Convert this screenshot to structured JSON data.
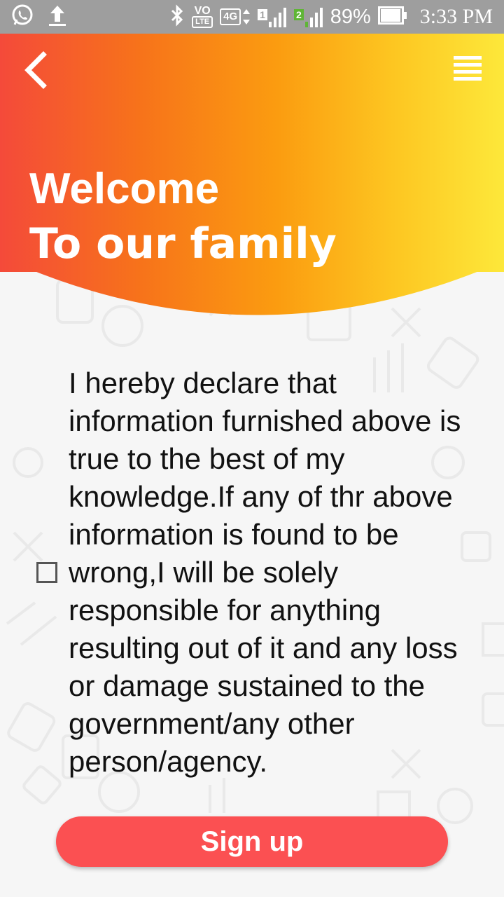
{
  "status_bar": {
    "left_icons": [
      "whatsapp-icon",
      "upload-icon"
    ],
    "right_icons": [
      "bluetooth-icon",
      "volte-icon",
      "network-4g-icon",
      "sim1-signal-icon",
      "sim2-signal-icon",
      "battery-icon"
    ],
    "volte_label": "VO",
    "lte_label": "LTE",
    "network_label": "4G",
    "sim1_label": "1",
    "sim2_label": "2",
    "battery": "89%",
    "time": "3:33 PM"
  },
  "header": {
    "back_icon": "chevron-left-icon",
    "menu_icon": "hamburger-menu-icon",
    "title": "Welcome",
    "subtitle": "To our family",
    "gradient_colors": [
      "#f44a3a",
      "#fb9c10",
      "#fde83a"
    ]
  },
  "declaration": {
    "checked": false,
    "text": "I hereby declare that information furnished above is true to the best of my knowledge.If any of thr above information is found to be wrong,I will be solely responsible for anything resulting out of it and any loss or damage sustained to the government/any other person/agency."
  },
  "signup": {
    "label": "Sign up",
    "color": "#fb5052"
  }
}
